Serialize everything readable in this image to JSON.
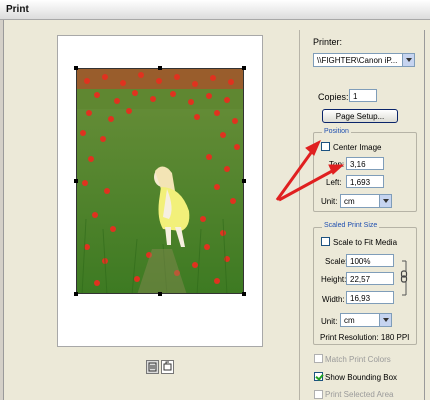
{
  "window": {
    "title": "Print"
  },
  "printer": {
    "label": "Printer:",
    "value": "\\\\FIGHTER\\Canon iP..."
  },
  "copies": {
    "label": "Copies:",
    "value": "1"
  },
  "page_setup_label": "Page Setup...",
  "position": {
    "title": "Position",
    "center_image_label": "Center Image",
    "top_label": "Top:",
    "top_value": "3,16",
    "left_label": "Left:",
    "left_value": "1,693",
    "unit_label": "Unit:",
    "unit_value": "cm"
  },
  "scaled_print_size": {
    "title": "Scaled Print Size",
    "scale_to_fit_label": "Scale to Fit Media",
    "scale_label": "Scale:",
    "scale_value": "100%",
    "height_label": "Height:",
    "height_value": "22,57",
    "width_label": "Width:",
    "width_value": "16,93",
    "unit_label": "Unit:",
    "unit_value": "cm",
    "resolution_text": "Print Resolution: 180 PPI"
  },
  "options": {
    "match_print_colors": "Match Print Colors",
    "show_bounding_box": "Show Bounding Box",
    "print_selected_area": "Print Selected Area",
    "show_bounding_box_checked": true
  },
  "colors": {
    "annotation_arrow": "#e02020",
    "group_title": "#1f4fb0"
  },
  "icons": [
    "printer-layout-icon",
    "rotate-icon",
    "dropdown-arrow-icon",
    "chain-link-icon",
    "annotation-arrow-icon"
  ]
}
